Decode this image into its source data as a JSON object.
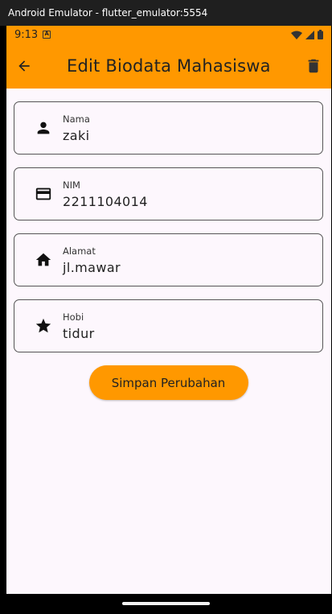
{
  "window": {
    "title": "Android Emulator - flutter_emulator:5554"
  },
  "status": {
    "time": "9:13"
  },
  "appbar": {
    "title": "Edit Biodata Mahasiswa"
  },
  "form": {
    "fields": [
      {
        "label": "Nama",
        "value": "zaki",
        "icon": "person-icon"
      },
      {
        "label": "NIM",
        "value": "2211104014",
        "icon": "credit-card-icon"
      },
      {
        "label": "Alamat",
        "value": "jl.mawar",
        "icon": "home-icon"
      },
      {
        "label": "Hobi",
        "value": "tidur",
        "icon": "star-icon"
      }
    ],
    "save_label": "Simpan Perubahan"
  },
  "colors": {
    "accent": "#ff9800",
    "background": "#fdf7fd"
  }
}
